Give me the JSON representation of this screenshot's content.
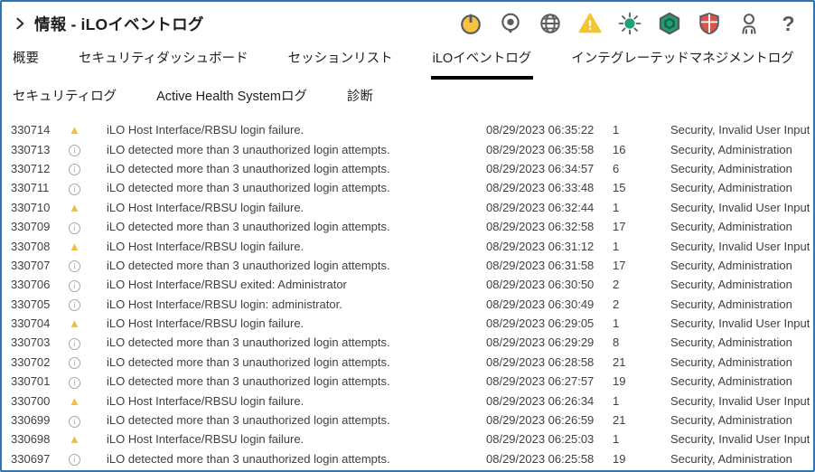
{
  "header": {
    "title": "情報 - iLOイベントログ",
    "help_glyph": "?",
    "icons": [
      {
        "name": "power-icon"
      },
      {
        "name": "uid-locator-icon"
      },
      {
        "name": "globe-icon"
      },
      {
        "name": "warning-status-icon"
      },
      {
        "name": "health-sun-icon"
      },
      {
        "name": "hexagon-status-icon"
      },
      {
        "name": "shield-status-icon"
      },
      {
        "name": "user-icon"
      },
      {
        "name": "help-icon"
      }
    ],
    "colors": {
      "border_blue": "#2E74B6",
      "amber": "#F5C431",
      "green": "#21A073",
      "red": "#D9534F",
      "icon_gray": "#5a5d60"
    }
  },
  "tabs": {
    "row1": [
      {
        "label": "概要",
        "active": false
      },
      {
        "label": "セキュリティダッシュボード",
        "active": false
      },
      {
        "label": "セッションリスト",
        "active": false
      },
      {
        "label": "iLOイベントログ",
        "active": true
      },
      {
        "label": "インテグレーテッドマネジメントログ",
        "active": false
      }
    ],
    "row2": [
      {
        "label": "セキュリティログ",
        "active": false
      },
      {
        "label": "Active Health Systemログ",
        "active": false
      },
      {
        "label": "診断",
        "active": false
      }
    ]
  },
  "table": {
    "rows": [
      {
        "id": "330714",
        "severity": "warning",
        "description": "iLO Host Interface/RBSU login failure.",
        "timestamp": "08/29/2023 06:35:22",
        "count": "1",
        "category": "Security, Invalid User Input"
      },
      {
        "id": "330713",
        "severity": "info",
        "description": "iLO detected more than 3 unauthorized login attempts.",
        "timestamp": "08/29/2023 06:35:58",
        "count": "16",
        "category": "Security, Administration"
      },
      {
        "id": "330712",
        "severity": "info",
        "description": "iLO detected more than 3 unauthorized login attempts.",
        "timestamp": "08/29/2023 06:34:57",
        "count": "6",
        "category": "Security, Administration"
      },
      {
        "id": "330711",
        "severity": "info",
        "description": "iLO detected more than 3 unauthorized login attempts.",
        "timestamp": "08/29/2023 06:33:48",
        "count": "15",
        "category": "Security, Administration"
      },
      {
        "id": "330710",
        "severity": "warning",
        "description": "iLO Host Interface/RBSU login failure.",
        "timestamp": "08/29/2023 06:32:44",
        "count": "1",
        "category": "Security, Invalid User Input"
      },
      {
        "id": "330709",
        "severity": "info",
        "description": "iLO detected more than 3 unauthorized login attempts.",
        "timestamp": "08/29/2023 06:32:58",
        "count": "17",
        "category": "Security, Administration"
      },
      {
        "id": "330708",
        "severity": "warning",
        "description": "iLO Host Interface/RBSU login failure.",
        "timestamp": "08/29/2023 06:31:12",
        "count": "1",
        "category": "Security, Invalid User Input"
      },
      {
        "id": "330707",
        "severity": "info",
        "description": "iLO detected more than 3 unauthorized login attempts.",
        "timestamp": "08/29/2023 06:31:58",
        "count": "17",
        "category": "Security, Administration"
      },
      {
        "id": "330706",
        "severity": "info",
        "description": "iLO Host Interface/RBSU exited: Administrator",
        "timestamp": "08/29/2023 06:30:50",
        "count": "2",
        "category": "Security, Administration"
      },
      {
        "id": "330705",
        "severity": "info",
        "description": "iLO Host Interface/RBSU login: administrator.",
        "timestamp": "08/29/2023 06:30:49",
        "count": "2",
        "category": "Security, Administration"
      },
      {
        "id": "330704",
        "severity": "warning",
        "description": "iLO Host Interface/RBSU login failure.",
        "timestamp": "08/29/2023 06:29:05",
        "count": "1",
        "category": "Security, Invalid User Input"
      },
      {
        "id": "330703",
        "severity": "info",
        "description": "iLO detected more than 3 unauthorized login attempts.",
        "timestamp": "08/29/2023 06:29:29",
        "count": "8",
        "category": "Security, Administration"
      },
      {
        "id": "330702",
        "severity": "info",
        "description": "iLO detected more than 3 unauthorized login attempts.",
        "timestamp": "08/29/2023 06:28:58",
        "count": "21",
        "category": "Security, Administration"
      },
      {
        "id": "330701",
        "severity": "info",
        "description": "iLO detected more than 3 unauthorized login attempts.",
        "timestamp": "08/29/2023 06:27:57",
        "count": "19",
        "category": "Security, Administration"
      },
      {
        "id": "330700",
        "severity": "warning",
        "description": "iLO Host Interface/RBSU login failure.",
        "timestamp": "08/29/2023 06:26:34",
        "count": "1",
        "category": "Security, Invalid User Input"
      },
      {
        "id": "330699",
        "severity": "info",
        "description": "iLO detected more than 3 unauthorized login attempts.",
        "timestamp": "08/29/2023 06:26:59",
        "count": "21",
        "category": "Security, Administration"
      },
      {
        "id": "330698",
        "severity": "warning",
        "description": "iLO Host Interface/RBSU login failure.",
        "timestamp": "08/29/2023 06:25:03",
        "count": "1",
        "category": "Security, Invalid User Input"
      },
      {
        "id": "330697",
        "severity": "info",
        "description": "iLO detected more than 3 unauthorized login attempts.",
        "timestamp": "08/29/2023 06:25:58",
        "count": "19",
        "category": "Security, Administration"
      }
    ]
  }
}
